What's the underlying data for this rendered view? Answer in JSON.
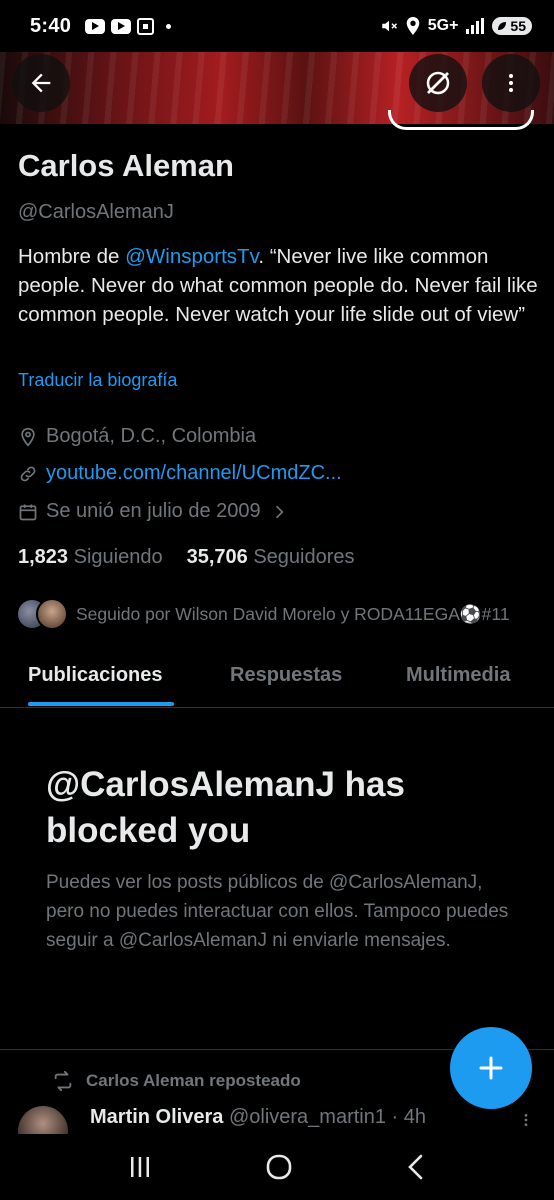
{
  "status_bar": {
    "time": "5:40",
    "network": "5G+",
    "battery": "55"
  },
  "profile": {
    "name": "Carlos Aleman",
    "handle": "@CarlosAlemanJ",
    "bio_prefix": "Hombre de ",
    "bio_mention": "@WinsportsTv",
    "bio_suffix": ". “Never live like common people. Never do what common people do. Never fail like common people. Never watch your life slide out of view”",
    "translate_label": "Traducir la biografía",
    "location": "Bogotá, D.C., Colombia",
    "website": "youtube.com/channel/UCmdZC...",
    "joined": "Se unió en julio de 2009",
    "following_count": "1,823",
    "following_label": "Siguiendo",
    "followers_count": "35,706",
    "followers_label": "Seguidores",
    "followed_by": "Seguido por Wilson David Morelo y RODA11EGA⚽#11"
  },
  "tabs": [
    {
      "label": "Publicaciones",
      "active": true
    },
    {
      "label": "Respuestas",
      "active": false
    },
    {
      "label": "Multimedia",
      "active": false
    }
  ],
  "blocked": {
    "title": "@CarlosAlemanJ has blocked you",
    "message": "Puedes ver los posts públicos de @CarlosAlemanJ, pero no puedes interactuar con ellos. Tampoco puedes seguir a @CarlosAlemanJ ni enviarle mensajes."
  },
  "repost": {
    "label": "Carlos Aleman reposteado",
    "tweet_name": "Martin Olivera",
    "tweet_handle": "@olivera_martin1",
    "tweet_time": "· 4h"
  },
  "colors": {
    "accent": "#1d9bf0",
    "background": "#000000",
    "text_primary": "#e7e9ea",
    "text_secondary": "#71767b"
  },
  "icons": [
    "back-arrow-icon",
    "grok-icon",
    "more-vertical-icon",
    "location-pin-icon",
    "link-icon",
    "calendar-icon",
    "chevron-right-icon",
    "repost-icon",
    "plus-icon",
    "recents-icon",
    "home-icon",
    "back-nav-icon"
  ]
}
